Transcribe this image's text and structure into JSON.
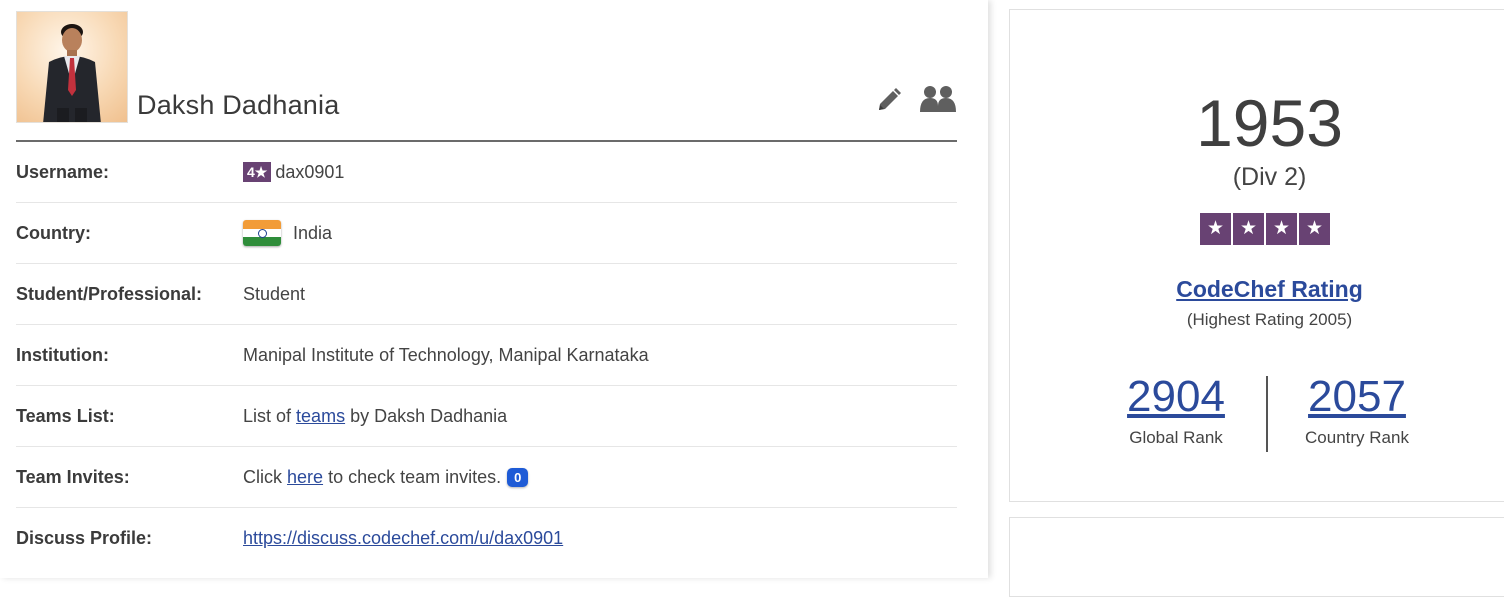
{
  "profile": {
    "name": "Daksh Dadhania",
    "details": [
      {
        "label": "Username:",
        "badge": "4★",
        "value": "dax0901"
      },
      {
        "label": "Country:",
        "value": "India"
      },
      {
        "label": "Student/Professional:",
        "value": "Student"
      },
      {
        "label": "Institution:",
        "value": "Manipal Institute of Technology, Manipal Karnataka"
      },
      {
        "label": "Teams List:",
        "prefix": "List of",
        "link": "teams",
        "suffix": "by Daksh Dadhania"
      },
      {
        "label": "Team Invites:",
        "prefix": "Click",
        "link": "here",
        "suffix": "to check team invites.",
        "count": "0"
      },
      {
        "label": "Discuss Profile:",
        "link": "https://discuss.codechef.com/u/dax0901"
      }
    ],
    "icons": {
      "edit": "pencil-icon",
      "teams": "group-icon"
    }
  },
  "rating": {
    "value": "1953",
    "division": "(Div 2)",
    "stars": [
      "★",
      "★",
      "★",
      "★"
    ],
    "title": "CodeChef Rating",
    "highest": "(Highest Rating 2005)",
    "global_rank": "2904",
    "global_rank_label": "Global Rank",
    "country_rank": "2057",
    "country_rank_label": "Country Rank"
  },
  "colors": {
    "star_purple": "#684273",
    "link_blue": "#2b4a9b",
    "badge_blue": "#1e5bd6"
  }
}
